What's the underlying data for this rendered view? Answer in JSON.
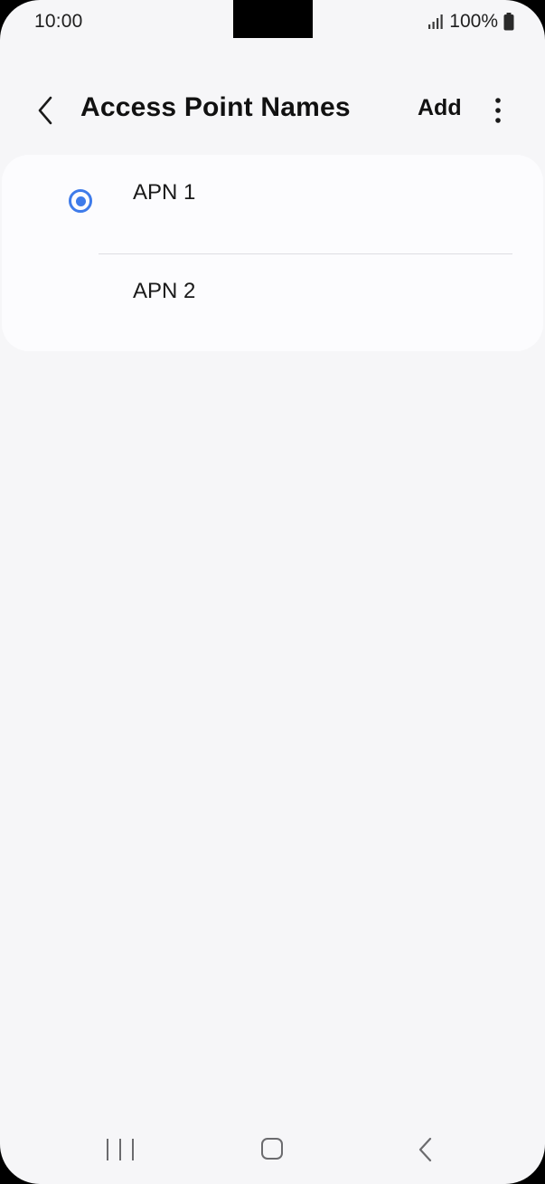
{
  "status_bar": {
    "time": "10:00",
    "battery_percent": "100%",
    "icons": [
      "signal-icon",
      "battery-icon"
    ]
  },
  "app_bar": {
    "title": "Access Point Names",
    "add_label": "Add",
    "icons": [
      "back-arrow-icon",
      "more-options-icon"
    ]
  },
  "apn_list": {
    "items": [
      {
        "label": "APN 1",
        "selected": true
      },
      {
        "label": "APN 2",
        "selected": false
      }
    ]
  },
  "nav_bar": {
    "icons": [
      "recent-apps-icon",
      "home-icon",
      "back-icon"
    ]
  },
  "colors": {
    "background": "#f6f6f8",
    "card": "#fcfcfe",
    "accent": "#3e7bea",
    "text": "#111111"
  }
}
